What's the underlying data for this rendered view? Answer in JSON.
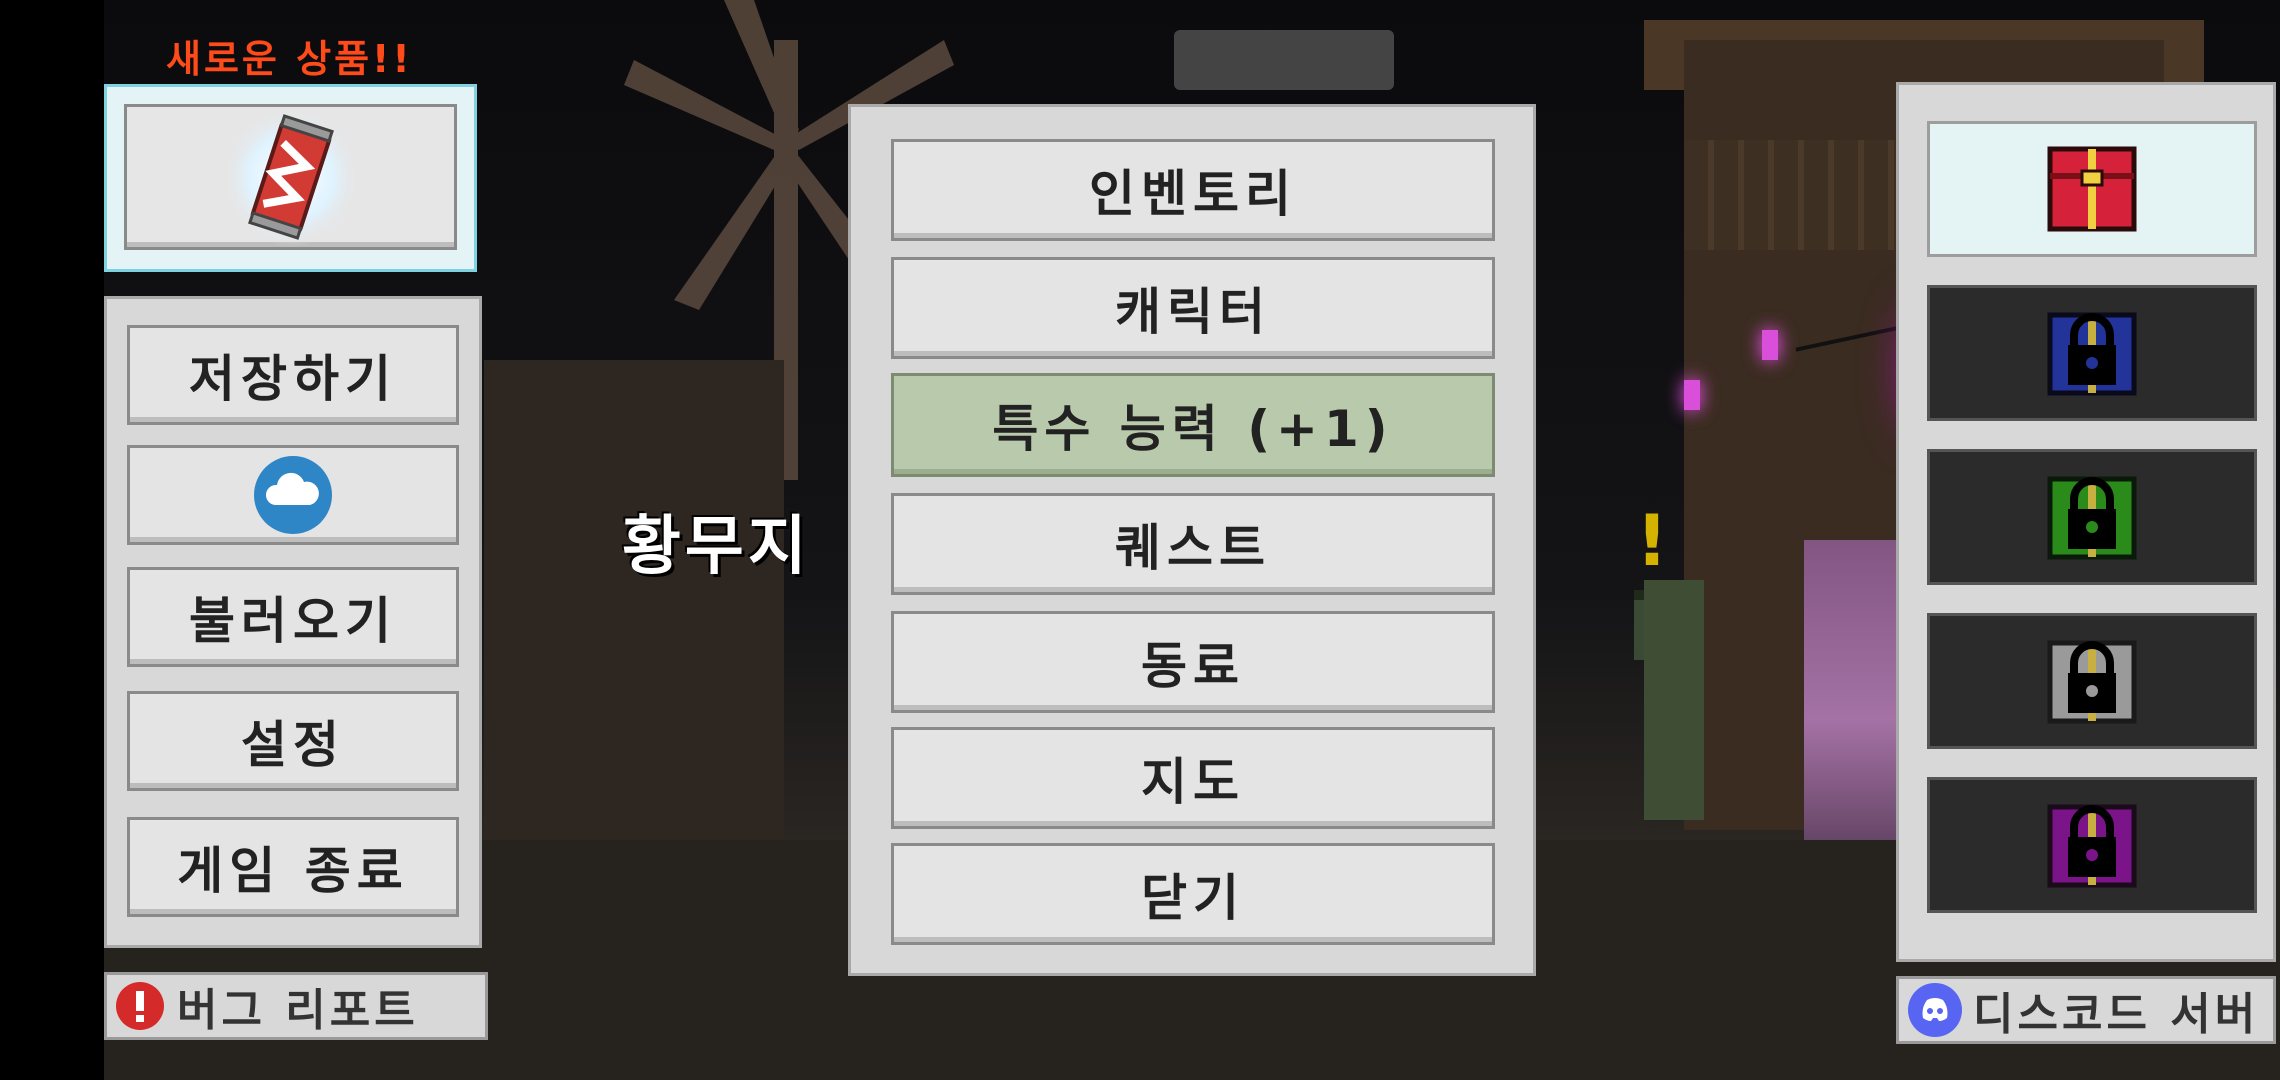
{
  "promo": {
    "label": "새로운 상품!!",
    "item_icon": "soda-can-icon"
  },
  "left_menu": {
    "save": "저장하기",
    "cloud_icon": "cloud-icon",
    "load": "불러오기",
    "settings": "설정",
    "quit": "게임 종료"
  },
  "region_name": "황무지",
  "center_menu": {
    "inventory": "인벤토리",
    "character": "캐릭터",
    "special_ability": "특수 능력 (+1)",
    "quest": "퀘스트",
    "companion": "동료",
    "map": "지도",
    "close": "닫기"
  },
  "chests": [
    {
      "name": "red-chest-icon",
      "color": "#d6213a",
      "locked": false
    },
    {
      "name": "blue-chest-icon",
      "color": "#22339a",
      "locked": true
    },
    {
      "name": "green-chest-icon",
      "color": "#2a8a1a",
      "locked": true
    },
    {
      "name": "silver-chest-icon",
      "color": "#9a9a9a",
      "locked": true
    },
    {
      "name": "purple-chest-icon",
      "color": "#7a1488",
      "locked": true
    }
  ],
  "bug_report": "버그 리포트",
  "discord": "디스코드 서버",
  "colors": {
    "promo_text": "#ff4a1a",
    "special_button": "#b9caac",
    "discord_blurple": "#5865f2",
    "alert_red": "#d42a2a"
  }
}
